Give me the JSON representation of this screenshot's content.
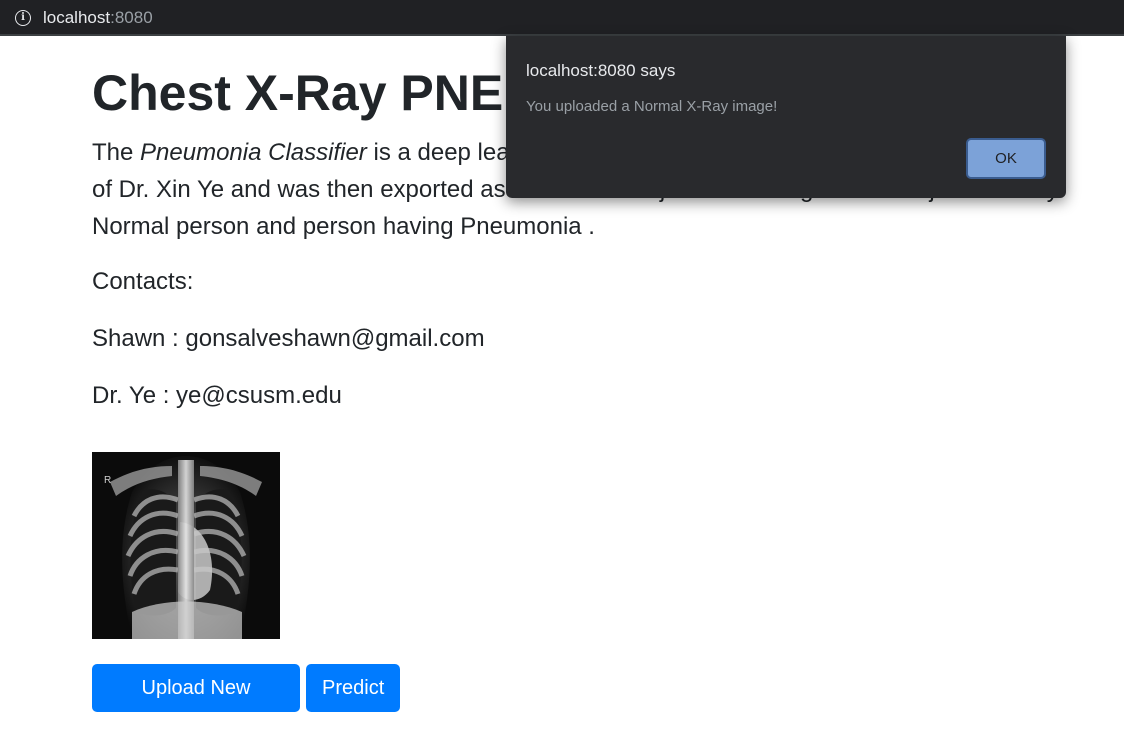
{
  "browser": {
    "url_host": "localhost",
    "url_port": ":8080"
  },
  "page": {
    "title": "Chest X-Ray PNEUMONIA Classifier",
    "lead": {
      "line1_prefix": "The ",
      "classifier_name": "Pneumonia Classifier",
      "line1_rest": " is a deep learning model built by Shawn",
      "line2": "of Dr. Xin Ye and was then exported as a TensorFlow.js model using tensorflowjs to classify",
      "line3": "Normal person and person having Pneumonia ."
    },
    "contacts_label": "Contacts:",
    "contact_shawn": "Shawn : gonsalveshawn@gmail.com",
    "contact_ye": "Dr. Ye : ye@csusm.edu",
    "image_marker": "R",
    "upload_button": "Upload New Picture",
    "predict_button": "Predict"
  },
  "dialog": {
    "title": "localhost:8080 says",
    "message": "You uploaded a Normal X-Ray image!",
    "ok_label": "OK"
  },
  "colors": {
    "primary_button": "#007bff",
    "dialog_bg": "#292a2d",
    "ok_button": "#7ca2d8"
  }
}
